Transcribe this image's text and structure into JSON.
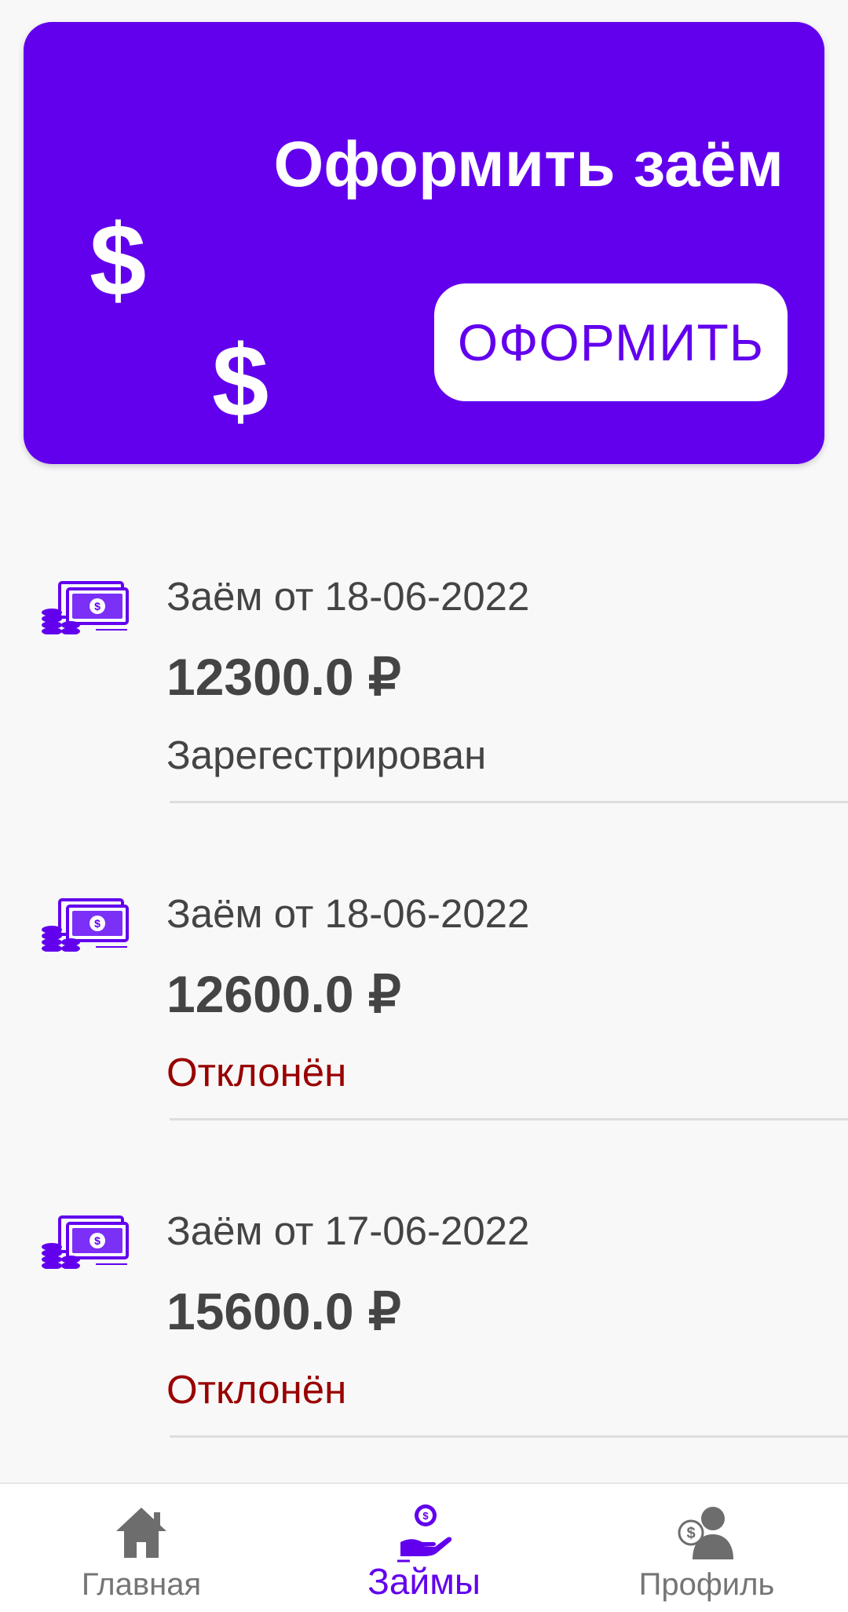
{
  "colors": {
    "accent": "#6200ee",
    "text_primary": "#444444",
    "status_rejected": "#990000",
    "nav_inactive": "#757575",
    "background": "#f8f8f8"
  },
  "promo": {
    "title": "Оформить заём",
    "dollar_symbol": "$",
    "button_label": "ОФОРМИТЬ",
    "icons": [
      "dollar-sign-icon",
      "dollar-sign-icon"
    ]
  },
  "loans": [
    {
      "date_label": "Заём от 18-06-2022",
      "amount": "12300.0 ₽",
      "status": "Зарегестрирован",
      "status_kind": "neutral",
      "icon": "money-stack-icon"
    },
    {
      "date_label": "Заём от 18-06-2022",
      "amount": "12600.0 ₽",
      "status": "Отклонён",
      "status_kind": "rejected",
      "icon": "money-stack-icon"
    },
    {
      "date_label": "Заём от 17-06-2022",
      "amount": "15600.0 ₽",
      "status": "Отклонён",
      "status_kind": "rejected",
      "icon": "money-stack-icon"
    }
  ],
  "bottom_nav": {
    "items": [
      {
        "label": "Главная",
        "icon": "home-icon",
        "active": false
      },
      {
        "label": "Займы",
        "icon": "loan-hand-icon",
        "active": true
      },
      {
        "label": "Профиль",
        "icon": "profile-icon",
        "active": false
      }
    ]
  }
}
